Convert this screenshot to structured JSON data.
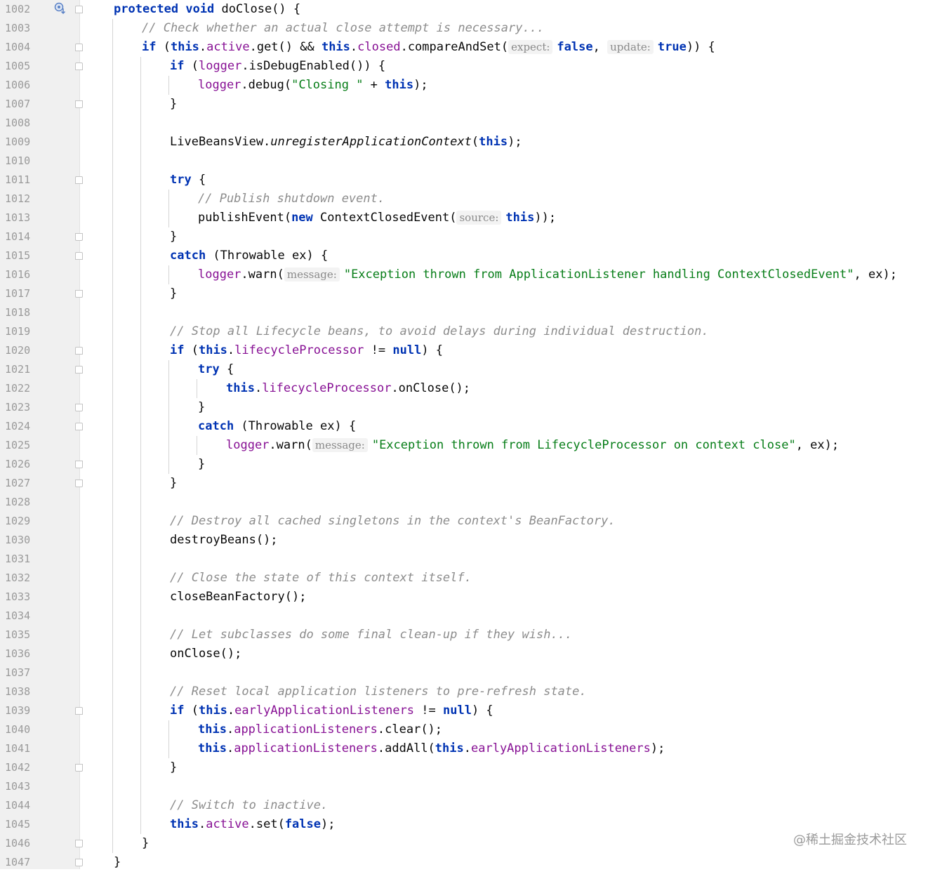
{
  "editor": {
    "line_numbers": [
      "1002",
      "1003",
      "1004",
      "1005",
      "1006",
      "1007",
      "1008",
      "1009",
      "1010",
      "1011",
      "1012",
      "1013",
      "1014",
      "1015",
      "1016",
      "1017",
      "1018",
      "1019",
      "1020",
      "1021",
      "1022",
      "1023",
      "1024",
      "1025",
      "1026",
      "1027",
      "1028",
      "1029",
      "1030",
      "1031",
      "1032",
      "1033",
      "1034",
      "1035",
      "1036",
      "1037",
      "1038",
      "1039",
      "1040",
      "1041",
      "1042",
      "1043",
      "1044",
      "1045",
      "1046",
      "1047"
    ],
    "gutter_icons": [
      {
        "line": "1002",
        "icon": "override-method-icon"
      }
    ],
    "code_lines": [
      [
        [
          "kw",
          "protected void "
        ],
        [
          "p",
          "doClose() {"
        ]
      ],
      [
        [
          "cmt",
          "// Check whether an actual close attempt is necessary..."
        ]
      ],
      [
        [
          "kw",
          "if "
        ],
        [
          "p",
          "("
        ],
        [
          "kw",
          "this"
        ],
        [
          "p",
          "."
        ],
        [
          "fld",
          "active"
        ],
        [
          "p",
          ".get() && "
        ],
        [
          "kw",
          "this"
        ],
        [
          "p",
          "."
        ],
        [
          "fld",
          "closed"
        ],
        [
          "p",
          ".compareAndSet("
        ],
        [
          "hint",
          "expect:"
        ],
        [
          "kw",
          "false"
        ],
        [
          "p",
          ", "
        ],
        [
          "hint",
          "update:"
        ],
        [
          "kw",
          "true"
        ],
        [
          "p",
          ")) {"
        ]
      ],
      [
        [
          "kw",
          "if "
        ],
        [
          "p",
          "("
        ],
        [
          "fld",
          "logger"
        ],
        [
          "p",
          ".isDebugEnabled()) {"
        ]
      ],
      [
        [
          "fld",
          "logger"
        ],
        [
          "p",
          ".debug("
        ],
        [
          "str",
          "\"Closing \""
        ],
        [
          "p",
          " + "
        ],
        [
          "kw",
          "this"
        ],
        [
          "p",
          ");"
        ]
      ],
      [
        [
          "p",
          "}"
        ]
      ],
      [],
      [
        [
          "p",
          "LiveBeansView."
        ],
        [
          "it",
          "unregisterApplicationContext"
        ],
        [
          "p",
          "("
        ],
        [
          "kw",
          "this"
        ],
        [
          "p",
          ");"
        ]
      ],
      [],
      [
        [
          "kw",
          "try "
        ],
        [
          "p",
          "{"
        ]
      ],
      [
        [
          "cmt",
          "// Publish shutdown event."
        ]
      ],
      [
        [
          "p",
          "publishEvent("
        ],
        [
          "kw",
          "new "
        ],
        [
          "p",
          "ContextClosedEvent("
        ],
        [
          "hint",
          "source:"
        ],
        [
          "kw",
          "this"
        ],
        [
          "p",
          "));"
        ]
      ],
      [
        [
          "p",
          "}"
        ]
      ],
      [
        [
          "kw",
          "catch "
        ],
        [
          "p",
          "(Throwable ex) {"
        ]
      ],
      [
        [
          "fld",
          "logger"
        ],
        [
          "p",
          ".warn("
        ],
        [
          "hint",
          "message:"
        ],
        [
          "str",
          "\"Exception thrown from ApplicationListener handling ContextClosedEvent\""
        ],
        [
          "p",
          ", ex);"
        ]
      ],
      [
        [
          "p",
          "}"
        ]
      ],
      [],
      [
        [
          "cmt",
          "// Stop all Lifecycle beans, to avoid delays during individual destruction."
        ]
      ],
      [
        [
          "kw",
          "if "
        ],
        [
          "p",
          "("
        ],
        [
          "kw",
          "this"
        ],
        [
          "p",
          "."
        ],
        [
          "fld",
          "lifecycleProcessor"
        ],
        [
          "p",
          " != "
        ],
        [
          "kw",
          "null"
        ],
        [
          "p",
          ") {"
        ]
      ],
      [
        [
          "kw",
          "try "
        ],
        [
          "p",
          "{"
        ]
      ],
      [
        [
          "kw",
          "this"
        ],
        [
          "p",
          "."
        ],
        [
          "fld",
          "lifecycleProcessor"
        ],
        [
          "p",
          ".onClose();"
        ]
      ],
      [
        [
          "p",
          "}"
        ]
      ],
      [
        [
          "kw",
          "catch "
        ],
        [
          "p",
          "(Throwable ex) {"
        ]
      ],
      [
        [
          "fld",
          "logger"
        ],
        [
          "p",
          ".warn("
        ],
        [
          "hint",
          "message:"
        ],
        [
          "str",
          "\"Exception thrown from LifecycleProcessor on context close\""
        ],
        [
          "p",
          ", ex);"
        ]
      ],
      [
        [
          "p",
          "}"
        ]
      ],
      [
        [
          "p",
          "}"
        ]
      ],
      [],
      [
        [
          "cmt",
          "// Destroy all cached singletons in the context's BeanFactory."
        ]
      ],
      [
        [
          "p",
          "destroyBeans();"
        ]
      ],
      [],
      [
        [
          "cmt",
          "// Close the state of this context itself."
        ]
      ],
      [
        [
          "p",
          "closeBeanFactory();"
        ]
      ],
      [],
      [
        [
          "cmt",
          "// Let subclasses do some final clean-up if they wish..."
        ]
      ],
      [
        [
          "p",
          "onClose();"
        ]
      ],
      [],
      [
        [
          "cmt",
          "// Reset local application listeners to pre-refresh state."
        ]
      ],
      [
        [
          "kw",
          "if "
        ],
        [
          "p",
          "("
        ],
        [
          "kw",
          "this"
        ],
        [
          "p",
          "."
        ],
        [
          "fld",
          "earlyApplicationListeners"
        ],
        [
          "p",
          " != "
        ],
        [
          "kw",
          "null"
        ],
        [
          "p",
          ") {"
        ]
      ],
      [
        [
          "kw",
          "this"
        ],
        [
          "p",
          "."
        ],
        [
          "fld",
          "applicationListeners"
        ],
        [
          "p",
          ".clear();"
        ]
      ],
      [
        [
          "kw",
          "this"
        ],
        [
          "p",
          "."
        ],
        [
          "fld",
          "applicationListeners"
        ],
        [
          "p",
          ".addAll("
        ],
        [
          "kw",
          "this"
        ],
        [
          "p",
          "."
        ],
        [
          "fld",
          "earlyApplicationListeners"
        ],
        [
          "p",
          ");"
        ]
      ],
      [
        [
          "p",
          "}"
        ]
      ],
      [],
      [
        [
          "cmt",
          "// Switch to inactive."
        ]
      ],
      [
        [
          "kw",
          "this"
        ],
        [
          "p",
          "."
        ],
        [
          "fld",
          "active"
        ],
        [
          "p",
          ".set("
        ],
        [
          "kw",
          "false"
        ],
        [
          "p",
          ");"
        ]
      ],
      [
        [
          "p",
          "}"
        ]
      ],
      [
        [
          "p",
          "}"
        ]
      ]
    ]
  },
  "watermark": "@稀土掘金技术社区",
  "colors": {
    "keyword": "#0033b3",
    "field": "#871094",
    "string": "#067d17",
    "comment": "#8c8c8c",
    "gutter_bg": "#f0f0f0",
    "line_number": "#9a9a9a"
  }
}
